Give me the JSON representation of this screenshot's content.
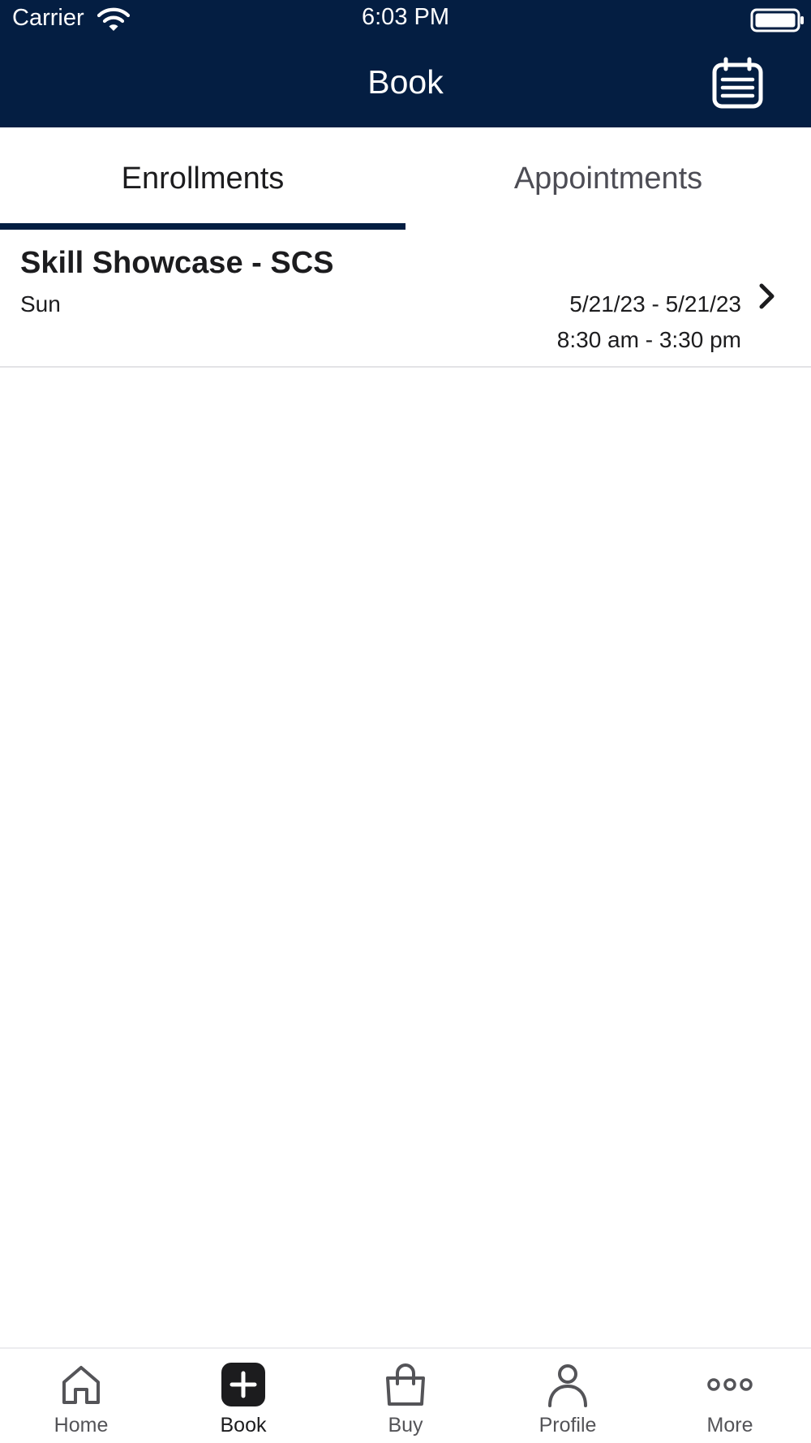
{
  "status_bar": {
    "carrier": "Carrier",
    "time": "6:03 PM"
  },
  "header": {
    "title": "Book",
    "calendar_icon": "calendar-list-icon",
    "background_color": "#041e42"
  },
  "tabs": [
    {
      "label": "Enrollments",
      "selected": true
    },
    {
      "label": "Appointments",
      "selected": false
    }
  ],
  "enrollments": [
    {
      "title": "Skill Showcase - SCS",
      "day": "Sun",
      "dates": "5/21/23 - 5/21/23",
      "times": "8:30 am - 3:30 pm"
    }
  ],
  "tab_bar": {
    "items": [
      {
        "label": "Home",
        "icon": "home-icon",
        "active": false
      },
      {
        "label": "Book",
        "icon": "plus-square-icon",
        "active": true
      },
      {
        "label": "Buy",
        "icon": "shopping-bag-icon",
        "active": false
      },
      {
        "label": "Profile",
        "icon": "person-icon",
        "active": false
      },
      {
        "label": "More",
        "icon": "more-dots-icon",
        "active": false
      }
    ]
  }
}
